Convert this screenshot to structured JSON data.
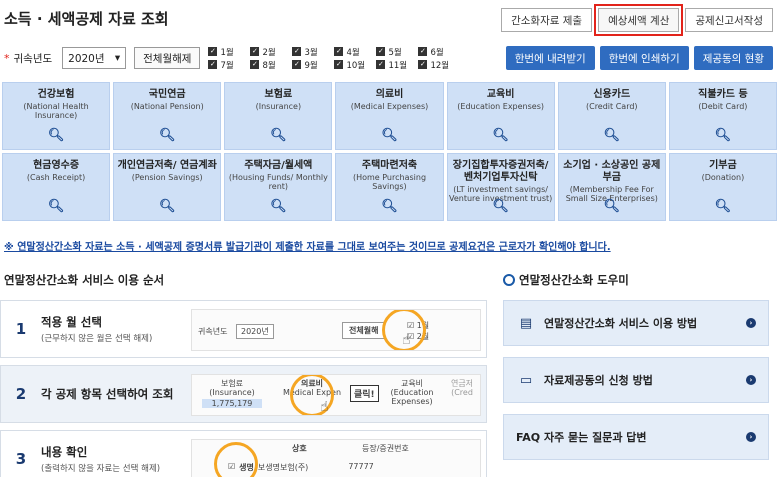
{
  "page": {
    "title": "소득 · 세액공제 자료 조회"
  },
  "top_buttons": [
    {
      "label": "간소화자료 제출"
    },
    {
      "label": "예상세액 계산"
    },
    {
      "label": "공제신고서작성"
    }
  ],
  "yearbar": {
    "required_mark": "*",
    "label": "귀속년도",
    "year_value": "2020년",
    "select_all": "전체월해제",
    "months": [
      "1월",
      "2월",
      "3월",
      "4월",
      "5월",
      "6월",
      "7월",
      "8월",
      "9월",
      "10월",
      "11월",
      "12월"
    ],
    "actions": [
      "한번에 내려받기",
      "한번에 인쇄하기",
      "제공동의 현황"
    ]
  },
  "tiles": [
    {
      "name": "건강보험",
      "sub": "(National Health Insurance)"
    },
    {
      "name": "국민연금",
      "sub": "(National Pension)"
    },
    {
      "name": "보험료",
      "sub": "(Insurance)"
    },
    {
      "name": "의료비",
      "sub": "(Medical Expenses)"
    },
    {
      "name": "교육비",
      "sub": "(Education Expenses)"
    },
    {
      "name": "신용카드",
      "sub": "(Credit Card)"
    },
    {
      "name": "직불카드 등",
      "sub": "(Debit Card)"
    },
    {
      "name": "현금영수증",
      "sub": "(Cash Receipt)"
    },
    {
      "name": "개인연금저축/ 연금계좌",
      "sub": "(Pension Savings)"
    },
    {
      "name": "주택자금/월세액",
      "sub": "(Housing Funds/ Monthly rent)"
    },
    {
      "name": "주택마련저축",
      "sub": "(Home Purchasing Savings)"
    },
    {
      "name": "장기집합투자증권저축/ 벤처기업투자신탁",
      "sub": "(LT investment savings/ Venture investment trust)"
    },
    {
      "name": "소기업 · 소상공인 공제부금",
      "sub": "(Membership Fee For Small Size Enterprises)"
    },
    {
      "name": "기부금",
      "sub": "(Donation)"
    }
  ],
  "notice": "※ 연말정산간소화 자료는 소득 · 세액공제 증명서류 발급기관이 제출한 자료를 그대로 보여주는 것이므로 공제요건은 근로자가 확인해야 합니다.",
  "sections": {
    "left": "연말정산간소화 서비스 이용 순서",
    "right": "연말정산간소화 도우미"
  },
  "steps": [
    {
      "num": "1",
      "title": "적용 월 선택",
      "sub": "(근무하지 않은 월은 선택 해제)",
      "mini": {
        "label": "귀속년도",
        "year": "2020년",
        "btn": "전체월해",
        "months": [
          "1월",
          "2월"
        ]
      }
    },
    {
      "num": "2",
      "title": "각 공제 항목 선택하여 조회",
      "sub": "",
      "mini": {
        "cols": [
          "보험료",
          "의료비",
          "교육비",
          "연금저"
        ],
        "col_subs": [
          "(Insurance)",
          "Medical Expen",
          "(Education Expenses)",
          "(Cred"
        ],
        "value": "1,775,179",
        "click": "클릭!"
      }
    },
    {
      "num": "3",
      "title": "내용 확인",
      "sub": "(출력하지 않을 자료는 선택 해제)",
      "mini": {
        "headers": [
          "상호",
          "등장/증권번호"
        ],
        "row": [
          "생명",
          "보생명보험(주)",
          "77777"
        ]
      }
    }
  ],
  "helpers": [
    {
      "icon": "guide-icon",
      "label": "연말정산간소화 서비스 이용 방법"
    },
    {
      "icon": "document-icon",
      "label": "자료제공동의 신청 방법"
    },
    {
      "icon": "faq-icon",
      "label": "FAQ 자주 묻는 질문과 답변"
    }
  ]
}
